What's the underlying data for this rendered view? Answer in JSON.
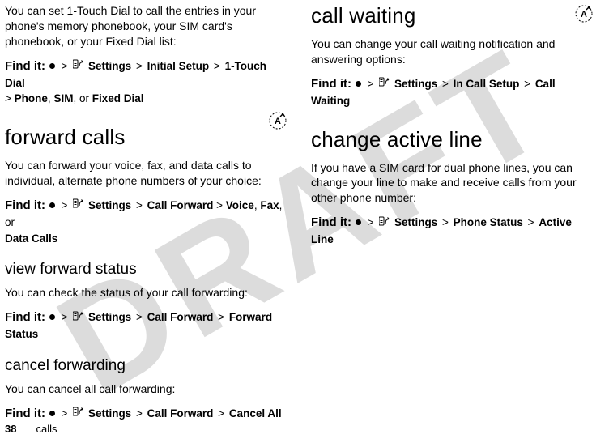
{
  "watermark": "DRAFT",
  "left": {
    "para1": "You can set 1-Touch Dial to call the entries in your phone's memory phonebook, your SIM card's phonebook, or your Fixed Dial list:",
    "findit1": {
      "label": "Find it:",
      "path": [
        "Settings",
        "Initial Setup",
        "1-Touch Dial"
      ],
      "tail_prefix": ">",
      "tail_bold1": "Phone",
      "tail_sep1": ", ",
      "tail_bold2": "SIM",
      "tail_sep2": ", or ",
      "tail_bold3": "Fixed Dial"
    },
    "h2a": "forward calls",
    "para2": "You can forward your voice, fax, and data calls to individual, alternate phone numbers of your choice:",
    "findit2": {
      "label": "Find it:",
      "path": [
        "Settings",
        "Call Forward"
      ],
      "tail_prefix": "> ",
      "tail_bold1": "Voice",
      "tail_sep1": ", ",
      "tail_bold2": "Fax",
      "tail_sep2": ", or ",
      "tail_bold3": "Data Calls"
    },
    "h3a": "view forward status",
    "para3": "You can check the status of your call forwarding:",
    "findit3": {
      "label": "Find it:",
      "path": [
        "Settings",
        "Call Forward",
        "Forward Status"
      ]
    },
    "h3b": "cancel forwarding",
    "para4": "You can cancel all call forwarding:",
    "findit4": {
      "label": "Find it:",
      "path": [
        "Settings",
        "Call Forward",
        "Cancel All"
      ]
    }
  },
  "right": {
    "h2a": "call waiting",
    "para1": "You can change your call waiting notification and answering options:",
    "findit1": {
      "label": "Find it:",
      "path": [
        "Settings",
        "In Call Setup",
        "Call Waiting"
      ]
    },
    "h2b": "change active line",
    "para2": "If you have a SIM card for dual phone lines, you can change your line to make and receive calls from your other phone number:",
    "findit2": {
      "label": "Find it:",
      "path": [
        "Settings",
        "Phone Status",
        "Active Line"
      ]
    }
  },
  "footer": {
    "page": "38",
    "section": "calls"
  },
  "icons": {
    "settings": "settings-icon",
    "dot": "dot-icon",
    "badge": "feature-badge"
  }
}
